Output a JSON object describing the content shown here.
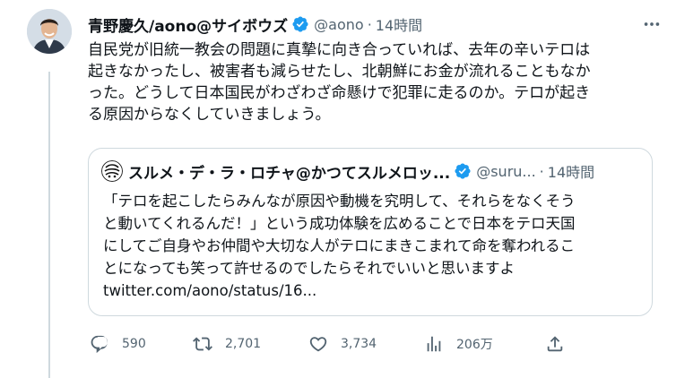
{
  "author": {
    "name": "青野慶久/aono@サイボウズ",
    "handle": "@aono",
    "separator": "·",
    "time": "14時間"
  },
  "tweet": {
    "lines": [
      "自民党が旧統一教会の問題に真摯に向き合っていれば、去年の辛いテロは",
      "起きなかったし、被害者も減らせたし、北朝鮮にお金が流れることもなか",
      "った。どうして日本国民がわざわざ命懸けで犯罪に走るのか。テロが起き",
      "る原因からなくしていきましょう。"
    ]
  },
  "quote": {
    "name": "スルメ・デ・ラ・ロチャ@かつてスルメロッ...",
    "handle": "@suru...",
    "separator": "·",
    "time": "14時間",
    "lines": [
      "「テロを起こしたらみんなが原因や動機を究明して、それらをなくそう",
      "と動いてくれるんだ！」という成功体験を広めることで日本をテロ天国",
      "にしてご自身やお仲間や大切な人がテロにまきこまれて命を奪われるこ",
      "とになっても笑って許せるのでしたらそれでいいと思いますよ",
      "twitter.com/aono/status/16..."
    ]
  },
  "actions": {
    "replies": "590",
    "retweets": "2,701",
    "likes": "3,734",
    "views": "206万"
  },
  "icons": {
    "verified": "verified-badge-icon",
    "more": "more-icon",
    "reply": "reply-icon",
    "retweet": "retweet-icon",
    "like": "heart-icon",
    "views": "views-icon",
    "share": "share-icon"
  },
  "colors": {
    "brand_blue": "#1d9bf0",
    "text_primary": "#0f1419",
    "text_secondary": "#536471",
    "border": "#cfd9de"
  }
}
